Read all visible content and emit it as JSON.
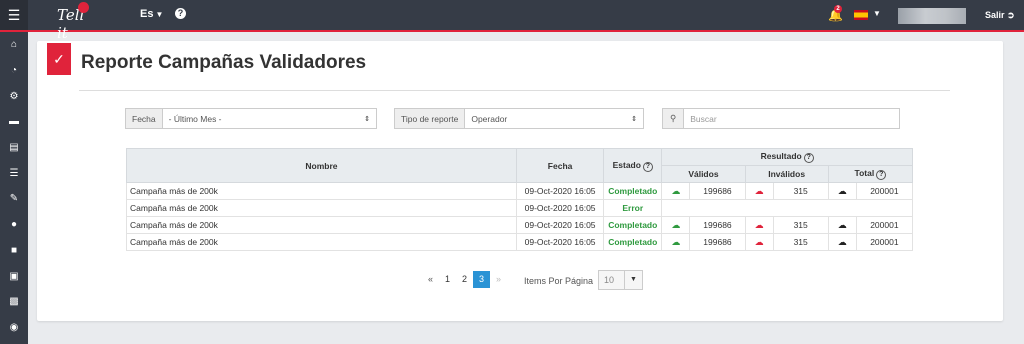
{
  "header": {
    "logo_text": "Tell it",
    "language": "Es",
    "help_symbol": "?",
    "notification_count": "2",
    "logout_label": "Salir"
  },
  "sidebar": {
    "items": [
      "home-icon",
      "chart-pie-icon",
      "users-gear-icon",
      "card-icon",
      "document-icon",
      "list-icon",
      "edit-icon",
      "chat-icon",
      "comment-icon",
      "report-icon",
      "inbox-icon",
      "conversations-icon"
    ]
  },
  "page": {
    "title": "Reporte Campañas Validadores"
  },
  "filters": {
    "fecha_label": "Fecha",
    "fecha_value": "- Último Mes -",
    "tipo_label": "Tipo de reporte",
    "tipo_value": "Operador",
    "search_placeholder": "Buscar"
  },
  "table": {
    "headers": {
      "nombre": "Nombre",
      "fecha": "Fecha",
      "estado": "Estado",
      "resultado": "Resultado",
      "validos": "Válidos",
      "invalidos": "Inválidos",
      "total": "Total"
    },
    "rows": [
      {
        "nombre": "Campaña más de 200k",
        "fecha": "09-Oct-2020 16:05",
        "estado": "Completado",
        "validos": "199686",
        "invalidos": "315",
        "total": "200001"
      },
      {
        "nombre": "Campaña más de 200k",
        "fecha": "09-Oct-2020 16:05",
        "estado": "Error",
        "validos": "",
        "invalidos": "",
        "total": ""
      },
      {
        "nombre": "Campaña más de 200k",
        "fecha": "09-Oct-2020 16:05",
        "estado": "Completado",
        "validos": "199686",
        "invalidos": "315",
        "total": "200001"
      },
      {
        "nombre": "Campaña más de 200k",
        "fecha": "09-Oct-2020 16:05",
        "estado": "Completado",
        "validos": "199686",
        "invalidos": "315",
        "total": "200001"
      }
    ]
  },
  "pagination": {
    "first": "«",
    "pages": [
      "1",
      "2",
      "3"
    ],
    "current": "3",
    "next": "»",
    "items_label": "Items Por Página",
    "per_page": "10"
  },
  "colors": {
    "accent": "#e0233b",
    "topbar": "#363c47",
    "active_page": "#2a93d5",
    "success": "#2f9a3f"
  }
}
